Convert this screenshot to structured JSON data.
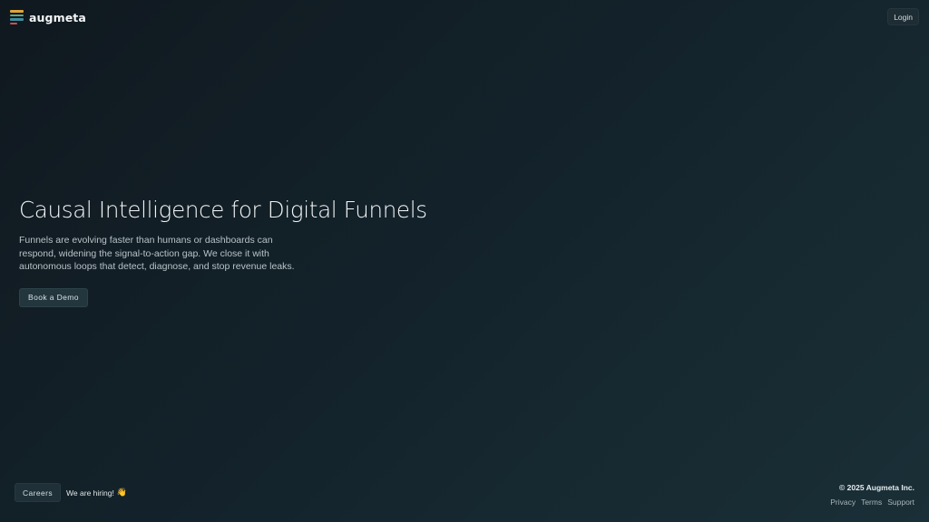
{
  "header": {
    "brand": "augmeta",
    "login_label": "Login",
    "logo_colors": [
      "#e0a33a",
      "#5fa87a",
      "#3f8ea0",
      "#c8524a"
    ]
  },
  "hero": {
    "title": "Causal Intelligence for Digital Funnels",
    "subtitle": "Funnels are evolving faster than humans or dashboards can respond, widening the signal-to-action gap. We close it with autonomous loops that detect, diagnose, and stop revenue leaks.",
    "cta_label": "Book a Demo"
  },
  "footer": {
    "careers_label": "Careers",
    "hiring_text": "We are hiring!",
    "hiring_icon": "👋",
    "copyright": "© 2025 Augmeta Inc.",
    "links": [
      "Privacy",
      "Terms",
      "Support"
    ]
  }
}
